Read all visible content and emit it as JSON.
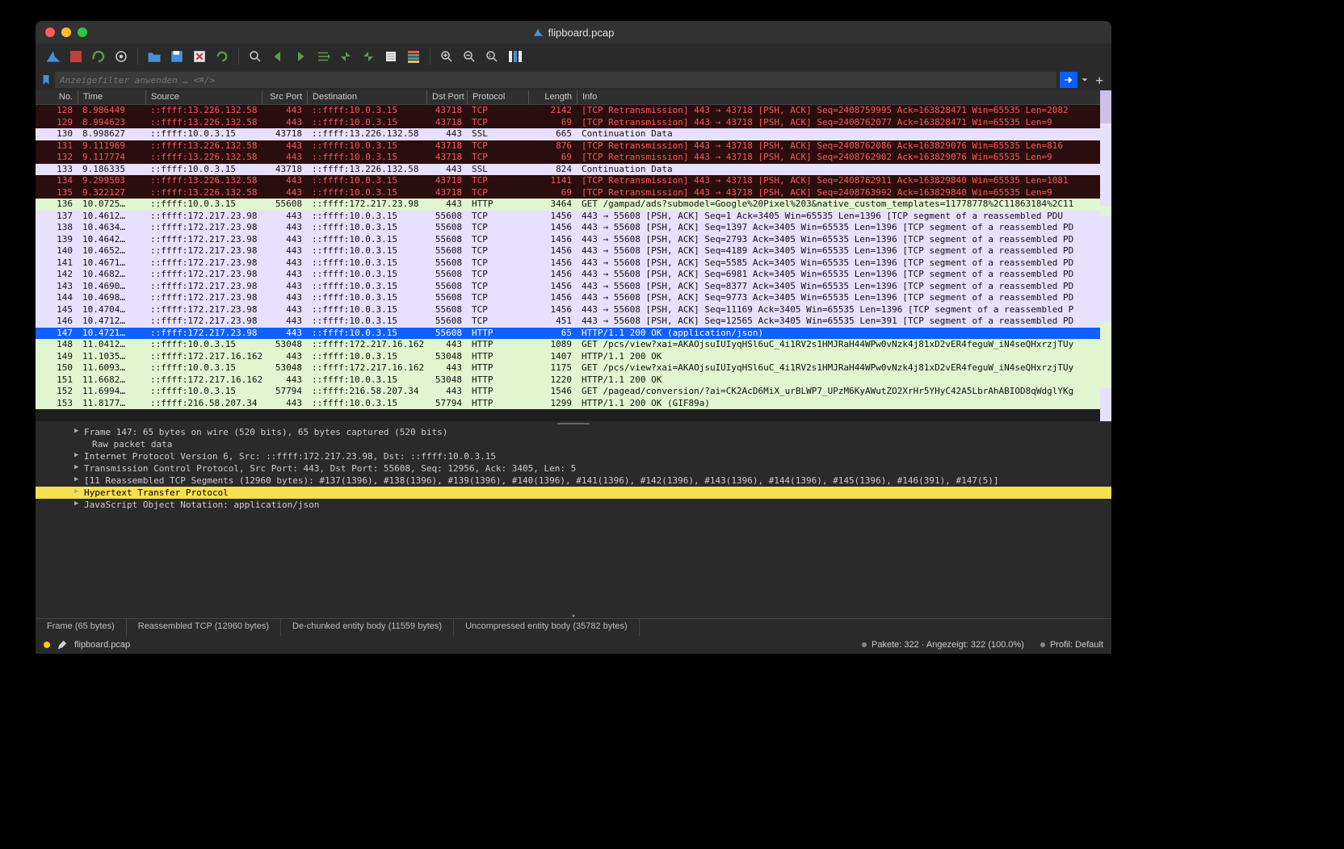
{
  "window": {
    "title": "flipboard.pcap"
  },
  "filter": {
    "placeholder": "Anzeigefilter anwenden … <⌘/>"
  },
  "columns": [
    "No.",
    "Time",
    "Source",
    "Src Port",
    "Destination",
    "Dst Port",
    "Protocol",
    "Length",
    "Info"
  ],
  "packets": [
    {
      "no": 128,
      "time": "8.986449",
      "src": "::ffff:13.226.132.58",
      "sp": 443,
      "dst": "::ffff:10.0.3.15",
      "dp": 43718,
      "proto": "TCP",
      "len": 2142,
      "info": "[TCP Retransmission] 443 → 43718 [PSH, ACK] Seq=2408759995 Ack=163828471 Win=65535 Len=2082",
      "cls": "r-ret"
    },
    {
      "no": 129,
      "time": "8.994623",
      "src": "::ffff:13.226.132.58",
      "sp": 443,
      "dst": "::ffff:10.0.3.15",
      "dp": 43718,
      "proto": "TCP",
      "len": 69,
      "info": "[TCP Retransmission] 443 → 43718 [PSH, ACK] Seq=2408762077 Ack=163828471 Win=65535 Len=9",
      "cls": "r-ret"
    },
    {
      "no": 130,
      "time": "8.998627",
      "src": "::ffff:10.0.3.15",
      "sp": 43718,
      "dst": "::ffff:13.226.132.58",
      "dp": 443,
      "proto": "SSL",
      "len": 665,
      "info": "Continuation Data",
      "cls": "r-ssl"
    },
    {
      "no": 131,
      "time": "9.111969",
      "src": "::ffff:13.226.132.58",
      "sp": 443,
      "dst": "::ffff:10.0.3.15",
      "dp": 43718,
      "proto": "TCP",
      "len": 876,
      "info": "[TCP Retransmission] 443 → 43718 [PSH, ACK] Seq=2408762086 Ack=163829076 Win=65535 Len=816",
      "cls": "r-ret"
    },
    {
      "no": 132,
      "time": "9.117774",
      "src": "::ffff:13.226.132.58",
      "sp": 443,
      "dst": "::ffff:10.0.3.15",
      "dp": 43718,
      "proto": "TCP",
      "len": 69,
      "info": "[TCP Retransmission] 443 → 43718 [PSH, ACK] Seq=2408762902 Ack=163829076 Win=65535 Len=9",
      "cls": "r-ret"
    },
    {
      "no": 133,
      "time": "9.186335",
      "src": "::ffff:10.0.3.15",
      "sp": 43718,
      "dst": "::ffff:13.226.132.58",
      "dp": 443,
      "proto": "SSL",
      "len": 824,
      "info": "Continuation Data",
      "cls": "r-ssl"
    },
    {
      "no": 134,
      "time": "9.299503",
      "src": "::ffff:13.226.132.58",
      "sp": 443,
      "dst": "::ffff:10.0.3.15",
      "dp": 43718,
      "proto": "TCP",
      "len": 1141,
      "info": "[TCP Retransmission] 443 → 43718 [PSH, ACK] Seq=2408762911 Ack=163829840 Win=65535 Len=1081",
      "cls": "r-ret"
    },
    {
      "no": 135,
      "time": "9.322127",
      "src": "::ffff:13.226.132.58",
      "sp": 443,
      "dst": "::ffff:10.0.3.15",
      "dp": 43718,
      "proto": "TCP",
      "len": 69,
      "info": "[TCP Retransmission] 443 → 43718 [PSH, ACK] Seq=2408763992 Ack=163829840 Win=65535 Len=9",
      "cls": "r-ret"
    },
    {
      "no": 136,
      "time": "10.0725…",
      "src": "::ffff:10.0.3.15",
      "sp": 55608,
      "dst": "::ffff:172.217.23.98",
      "dp": 443,
      "proto": "HTTP",
      "len": 3464,
      "info": "GET /gampad/ads?submodel=Google%20Pixel%203&native_custom_templates=11778778%2C11863184%2C11",
      "cls": "r-http"
    },
    {
      "no": 137,
      "time": "10.4612…",
      "src": "::ffff:172.217.23.98",
      "sp": 443,
      "dst": "::ffff:10.0.3.15",
      "dp": 55608,
      "proto": "TCP",
      "len": 1456,
      "info": "443 → 55608 [PSH, ACK] Seq=1 Ack=3405 Win=65535 Len=1396 [TCP segment of a reassembled PDU",
      "cls": "r-tcp"
    },
    {
      "no": 138,
      "time": "10.4634…",
      "src": "::ffff:172.217.23.98",
      "sp": 443,
      "dst": "::ffff:10.0.3.15",
      "dp": 55608,
      "proto": "TCP",
      "len": 1456,
      "info": "443 → 55608 [PSH, ACK] Seq=1397 Ack=3405 Win=65535 Len=1396 [TCP segment of a reassembled PD",
      "cls": "r-tcp"
    },
    {
      "no": 139,
      "time": "10.4642…",
      "src": "::ffff:172.217.23.98",
      "sp": 443,
      "dst": "::ffff:10.0.3.15",
      "dp": 55608,
      "proto": "TCP",
      "len": 1456,
      "info": "443 → 55608 [PSH, ACK] Seq=2793 Ack=3405 Win=65535 Len=1396 [TCP segment of a reassembled PD",
      "cls": "r-tcp"
    },
    {
      "no": 140,
      "time": "10.4652…",
      "src": "::ffff:172.217.23.98",
      "sp": 443,
      "dst": "::ffff:10.0.3.15",
      "dp": 55608,
      "proto": "TCP",
      "len": 1456,
      "info": "443 → 55608 [PSH, ACK] Seq=4189 Ack=3405 Win=65535 Len=1396 [TCP segment of a reassembled PD",
      "cls": "r-tcp"
    },
    {
      "no": 141,
      "time": "10.4671…",
      "src": "::ffff:172.217.23.98",
      "sp": 443,
      "dst": "::ffff:10.0.3.15",
      "dp": 55608,
      "proto": "TCP",
      "len": 1456,
      "info": "443 → 55608 [PSH, ACK] Seq=5585 Ack=3405 Win=65535 Len=1396 [TCP segment of a reassembled PD",
      "cls": "r-tcp"
    },
    {
      "no": 142,
      "time": "10.4682…",
      "src": "::ffff:172.217.23.98",
      "sp": 443,
      "dst": "::ffff:10.0.3.15",
      "dp": 55608,
      "proto": "TCP",
      "len": 1456,
      "info": "443 → 55608 [PSH, ACK] Seq=6981 Ack=3405 Win=65535 Len=1396 [TCP segment of a reassembled PD",
      "cls": "r-tcp"
    },
    {
      "no": 143,
      "time": "10.4690…",
      "src": "::ffff:172.217.23.98",
      "sp": 443,
      "dst": "::ffff:10.0.3.15",
      "dp": 55608,
      "proto": "TCP",
      "len": 1456,
      "info": "443 → 55608 [PSH, ACK] Seq=8377 Ack=3405 Win=65535 Len=1396 [TCP segment of a reassembled PD",
      "cls": "r-tcp"
    },
    {
      "no": 144,
      "time": "10.4698…",
      "src": "::ffff:172.217.23.98",
      "sp": 443,
      "dst": "::ffff:10.0.3.15",
      "dp": 55608,
      "proto": "TCP",
      "len": 1456,
      "info": "443 → 55608 [PSH, ACK] Seq=9773 Ack=3405 Win=65535 Len=1396 [TCP segment of a reassembled PD",
      "cls": "r-tcp"
    },
    {
      "no": 145,
      "time": "10.4704…",
      "src": "::ffff:172.217.23.98",
      "sp": 443,
      "dst": "::ffff:10.0.3.15",
      "dp": 55608,
      "proto": "TCP",
      "len": 1456,
      "info": "443 → 55608 [PSH, ACK] Seq=11169 Ack=3405 Win=65535 Len=1396 [TCP segment of a reassembled P",
      "cls": "r-tcp"
    },
    {
      "no": 146,
      "time": "10.4712…",
      "src": "::ffff:172.217.23.98",
      "sp": 443,
      "dst": "::ffff:10.0.3.15",
      "dp": 55608,
      "proto": "TCP",
      "len": 451,
      "info": "443 → 55608 [PSH, ACK] Seq=12565 Ack=3405 Win=65535 Len=391 [TCP segment of a reassembled PD",
      "cls": "r-tcp"
    },
    {
      "no": 147,
      "time": "10.4721…",
      "src": "::ffff:172.217.23.98",
      "sp": 443,
      "dst": "::ffff:10.0.3.15",
      "dp": 55608,
      "proto": "HTTP",
      "len": 65,
      "info": "HTTP/1.1 200 OK  (application/json)",
      "cls": "r-sel"
    },
    {
      "no": 148,
      "time": "11.0412…",
      "src": "::ffff:10.0.3.15",
      "sp": 53048,
      "dst": "::ffff:172.217.16.162",
      "dp": 443,
      "proto": "HTTP",
      "len": 1089,
      "info": "GET /pcs/view?xai=AKAOjsuIUIyqHSl6uC_4i1RV2s1HMJRaH44WPw0vNzk4j81xD2vER4feguW_iN4seQHxrzjTUy",
      "cls": "r-http"
    },
    {
      "no": 149,
      "time": "11.1035…",
      "src": "::ffff:172.217.16.162",
      "sp": 443,
      "dst": "::ffff:10.0.3.15",
      "dp": 53048,
      "proto": "HTTP",
      "len": 1407,
      "info": "HTTP/1.1 200 OK",
      "cls": "r-http"
    },
    {
      "no": 150,
      "time": "11.6093…",
      "src": "::ffff:10.0.3.15",
      "sp": 53048,
      "dst": "::ffff:172.217.16.162",
      "dp": 443,
      "proto": "HTTP",
      "len": 1175,
      "info": "GET /pcs/view?xai=AKAOjsuIUIyqHSl6uC_4i1RV2s1HMJRaH44WPw0vNzk4j81xD2vER4feguW_iN4seQHxrzjTUy",
      "cls": "r-http"
    },
    {
      "no": 151,
      "time": "11.6682…",
      "src": "::ffff:172.217.16.162",
      "sp": 443,
      "dst": "::ffff:10.0.3.15",
      "dp": 53048,
      "proto": "HTTP",
      "len": 1220,
      "info": "HTTP/1.1 200 OK",
      "cls": "r-http"
    },
    {
      "no": 152,
      "time": "11.6994…",
      "src": "::ffff:10.0.3.15",
      "sp": 57794,
      "dst": "::ffff:216.58.207.34",
      "dp": 443,
      "proto": "HTTP",
      "len": 1546,
      "info": "GET /pagead/conversion/?ai=CK2AcD6MiX_urBLWP7_UPzM6KyAWutZO2XrHr5YHyC42A5LbrAhABIOD8qWdglYKg",
      "cls": "r-http"
    },
    {
      "no": 153,
      "time": "11.8177…",
      "src": "::ffff:216.58.207.34",
      "sp": 443,
      "dst": "::ffff:10.0.3.15",
      "dp": 57794,
      "proto": "HTTP",
      "len": 1299,
      "info": "HTTP/1.1 200 OK  (GIF89a)",
      "cls": "r-http"
    }
  ],
  "details": [
    {
      "text": "Frame 147: 65 bytes on wire (520 bits), 65 bytes captured (520 bits)"
    },
    {
      "text": "Raw packet data",
      "noexp": true
    },
    {
      "text": "Internet Protocol Version 6, Src: ::ffff:172.217.23.98, Dst: ::ffff:10.0.3.15"
    },
    {
      "text": "Transmission Control Protocol, Src Port: 443, Dst Port: 55608, Seq: 12956, Ack: 3405, Len: 5"
    },
    {
      "text": "[11 Reassembled TCP Segments (12960 bytes): #137(1396), #138(1396), #139(1396), #140(1396), #141(1396), #142(1396), #143(1396), #144(1396), #145(1396), #146(391), #147(5)]"
    },
    {
      "text": "Hypertext Transfer Protocol",
      "hl": true
    },
    {
      "text": "JavaScript Object Notation: application/json"
    }
  ],
  "tabs": [
    "Frame (65 bytes)",
    "Reassembled TCP (12960 bytes)",
    "De-chunked entity body (11559 bytes)",
    "Uncompressed entity body (35782 bytes)"
  ],
  "status": {
    "file": "flipboard.pcap",
    "packets": "Pakete: 322 · Angezeigt: 322 (100.0%)",
    "profile": "Profil: Default"
  }
}
